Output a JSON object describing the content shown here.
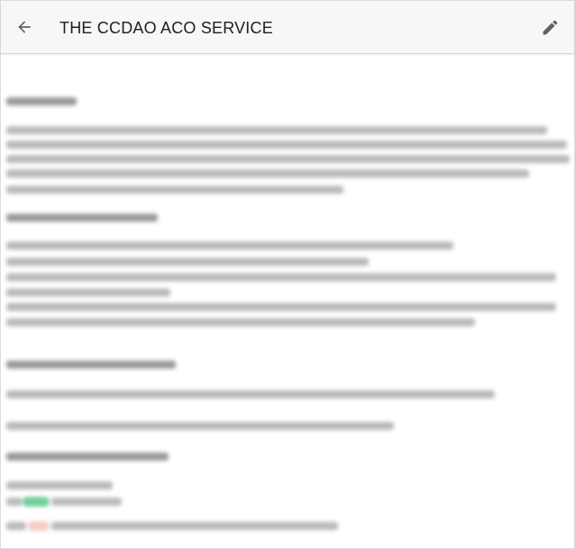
{
  "header": {
    "title": "THE CCDAO ACO SERVICE",
    "back_icon": "arrow-back-icon",
    "edit_icon": "pencil-icon"
  },
  "colors": {
    "app_bar_bg": "#f7f7f7",
    "icon": "#616161",
    "title_text": "#202020",
    "status_green": "#43c17a",
    "status_red": "#f2b8a8"
  }
}
